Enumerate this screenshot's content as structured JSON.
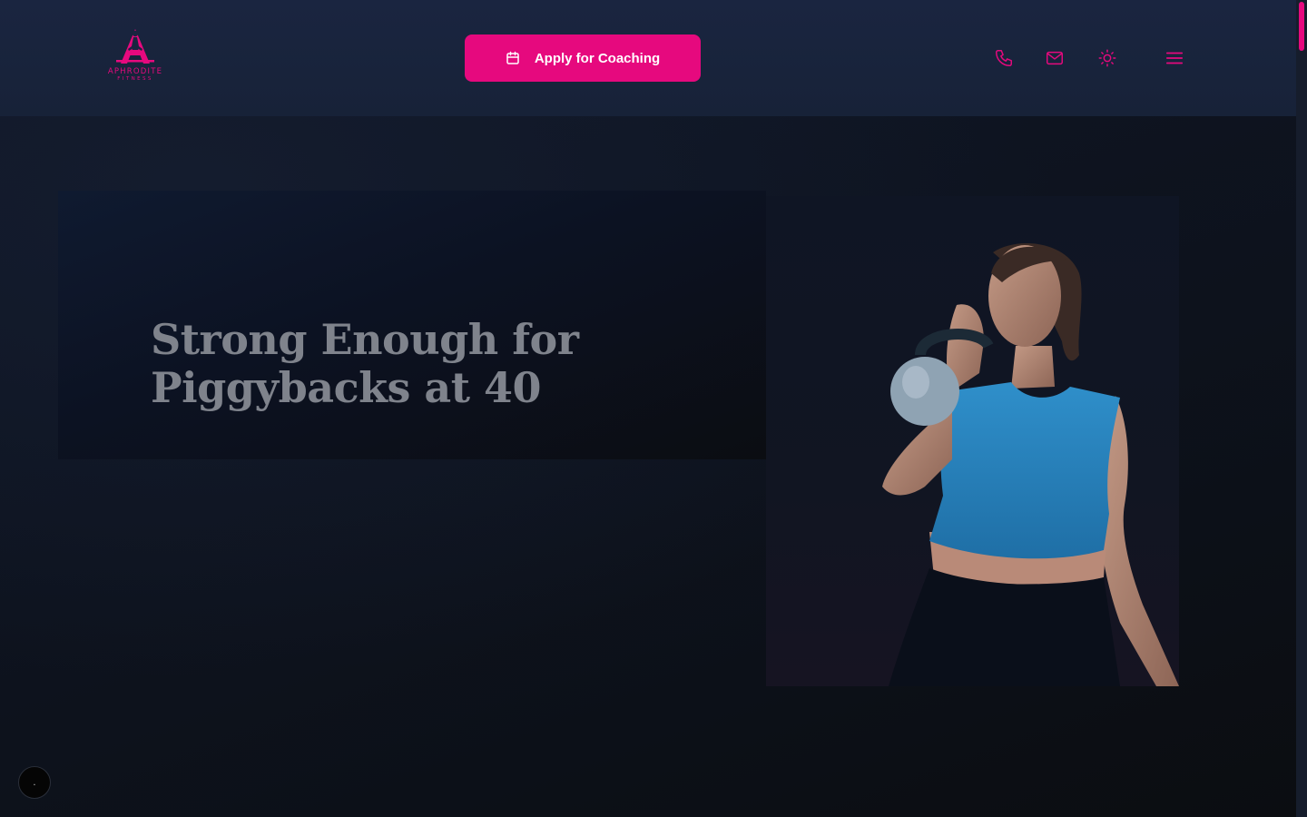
{
  "brand": {
    "name": "APHRODITE",
    "tagline": "FITNESS",
    "accent_color": "#e6097e"
  },
  "header": {
    "cta_label": "Apply for Coaching",
    "cta_icon": "calendar-icon",
    "icons": [
      "phone-icon",
      "mail-icon",
      "sun-icon",
      "menu-icon"
    ]
  },
  "hero": {
    "title": "Strong Enough for Piggybacks at 40",
    "image": "woman-holding-kettlebell-photo"
  },
  "chat": {
    "label": "."
  }
}
